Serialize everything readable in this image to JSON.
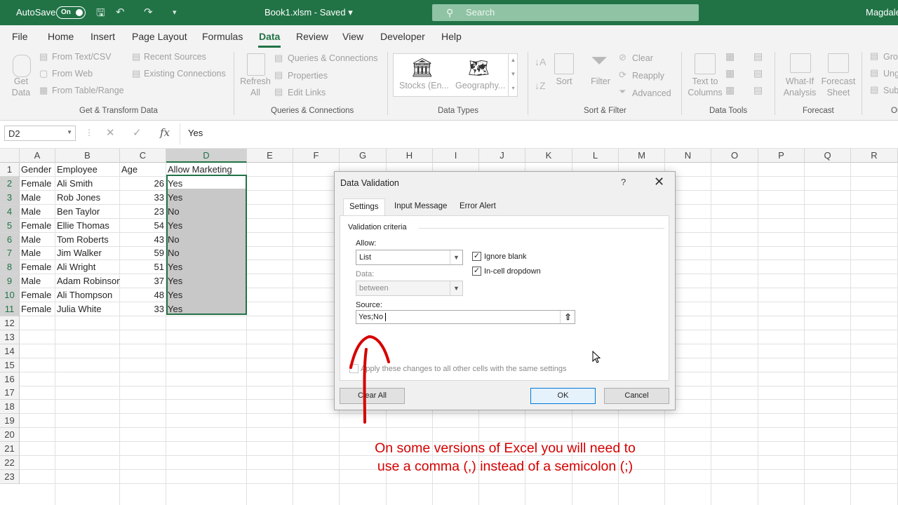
{
  "titlebar": {
    "autosave_label": "AutoSave",
    "autosave_state": "On",
    "document": "Book1.xlsm - Saved",
    "search_placeholder": "Search",
    "user": "Magdale"
  },
  "menu": {
    "tabs": [
      "File",
      "Home",
      "Insert",
      "Page Layout",
      "Formulas",
      "Data",
      "Review",
      "View",
      "Developer",
      "Help"
    ],
    "active": "Data"
  },
  "ribbon": {
    "get_data": "Get Data",
    "from_text_csv": "From Text/CSV",
    "from_web": "From Web",
    "from_table_range": "From Table/Range",
    "recent_sources": "Recent Sources",
    "existing_connections": "Existing Connections",
    "group_get_transform": "Get & Transform Data",
    "refresh_all": "Refresh All",
    "queries_connections": "Queries & Connections",
    "properties": "Properties",
    "edit_links": "Edit Links",
    "group_queries": "Queries & Connections",
    "stocks": "Stocks (En...",
    "geography": "Geography...",
    "group_data_types": "Data Types",
    "sort": "Sort",
    "filter": "Filter",
    "clear": "Clear",
    "reapply": "Reapply",
    "advanced": "Advanced",
    "group_sort_filter": "Sort & Filter",
    "text_to_columns": "Text to Columns",
    "group_data_tools": "Data Tools",
    "what_if": "What-If Analysis",
    "forecast_sheet": "Forecast Sheet",
    "group_forecast": "Forecast",
    "group_button": "Gro",
    "ungroup_button": "Ung",
    "subtotal_button": "Sub",
    "group_outline": "Ou"
  },
  "formula_bar": {
    "name_box": "D2",
    "value": "Yes"
  },
  "sheet": {
    "columns": [
      "A",
      "B",
      "C",
      "D",
      "E",
      "F",
      "G",
      "H",
      "I",
      "J",
      "K",
      "L",
      "M",
      "N",
      "O",
      "P",
      "Q",
      "R"
    ],
    "row_numbers": [
      "1",
      "2",
      "3",
      "4",
      "5",
      "6",
      "7",
      "8",
      "9",
      "10",
      "11",
      "12",
      "13",
      "14",
      "15",
      "16",
      "17",
      "18",
      "19",
      "20",
      "21",
      "22",
      "23"
    ],
    "headers": [
      "Gender",
      "Employee",
      "Age",
      "Allow Marketing"
    ],
    "rows": [
      [
        "Female",
        "Ali Smith",
        "26",
        "Yes"
      ],
      [
        "Male",
        "Rob Jones",
        "33",
        "Yes"
      ],
      [
        "Male",
        "Ben Taylor",
        "23",
        "No"
      ],
      [
        "Female",
        "Ellie Thomas",
        "54",
        "Yes"
      ],
      [
        "Male",
        "Tom Roberts",
        "43",
        "No"
      ],
      [
        "Male",
        "Jim Walker",
        "59",
        "No"
      ],
      [
        "Female",
        "Ali Wright",
        "51",
        "Yes"
      ],
      [
        "Male",
        "Adam Robinson",
        "37",
        "Yes"
      ],
      [
        "Female",
        "Ali Thompson",
        "48",
        "Yes"
      ],
      [
        "Female",
        "Julia White",
        "33",
        "Yes"
      ]
    ]
  },
  "dialog": {
    "title": "Data Validation",
    "help": "?",
    "close": "✕",
    "tabs": [
      "Settings",
      "Input Message",
      "Error Alert"
    ],
    "section": "Validation criteria",
    "allow_label": "Allow:",
    "allow_value": "List",
    "data_label": "Data:",
    "data_value": "between",
    "ignore_blank": "Ignore blank",
    "in_cell_dropdown": "In-cell dropdown",
    "source_label": "Source:",
    "source_value": "Yes;No",
    "apply_all": "Apply these changes to all other cells with the same settings",
    "clear_all": "Clear All",
    "ok": "OK",
    "cancel": "Cancel"
  },
  "annotation": {
    "line1": "On some versions of Excel you will need to",
    "line2": "use a comma (,) instead of a semicolon (;)",
    "color": "#d50000"
  },
  "colors": {
    "excel_green": "#217346",
    "selection_fill": "#c8c8c8"
  }
}
